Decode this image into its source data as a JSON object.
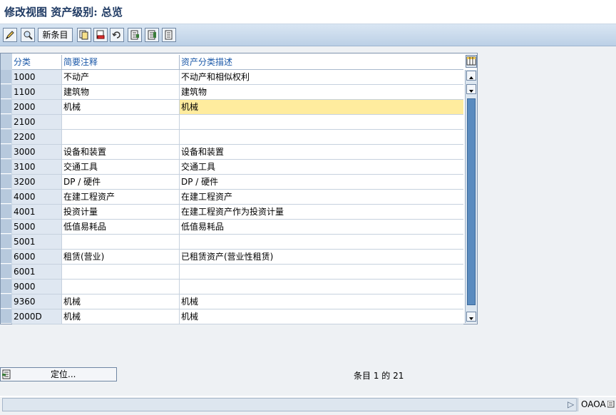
{
  "title": "修改视图 资产级别: 总览",
  "toolbar": {
    "new_entries_label": "新条目",
    "icons": [
      "edit-icon",
      "display-icon",
      "copy-icon",
      "delete-icon",
      "undo-icon",
      "select-all-icon",
      "select-block-icon",
      "deselect-all-icon"
    ]
  },
  "table": {
    "headers": [
      "分类",
      "简要注释",
      "资产分类描述"
    ],
    "rows": [
      {
        "key": "1000",
        "short": "不动产",
        "desc": "不动产和相似权利"
      },
      {
        "key": "1100",
        "short": "建筑物",
        "desc": "建筑物"
      },
      {
        "key": "2000",
        "short": "机械",
        "desc": "机械"
      },
      {
        "key": "2100",
        "short": "",
        "desc": ""
      },
      {
        "key": "2200",
        "short": "",
        "desc": ""
      },
      {
        "key": "3000",
        "short": "设备和装置",
        "desc": "设备和装置"
      },
      {
        "key": "3100",
        "short": "交通工具",
        "desc": "交通工具"
      },
      {
        "key": "3200",
        "short": "DP / 硬件",
        "desc": "DP / 硬件"
      },
      {
        "key": "4000",
        "short": "在建工程资产",
        "desc": "在建工程资产"
      },
      {
        "key": "4001",
        "short": "投资计量",
        "desc": "在建工程资产作为投资计量"
      },
      {
        "key": "5000",
        "short": "低值易耗品",
        "desc": "低值易耗品"
      },
      {
        "key": "5001",
        "short": "",
        "desc": ""
      },
      {
        "key": "6000",
        "short": "租赁(营业)",
        "desc": "已租赁资产(营业性租赁)"
      },
      {
        "key": "6001",
        "short": "",
        "desc": ""
      },
      {
        "key": "9000",
        "short": "",
        "desc": ""
      },
      {
        "key": "9360",
        "short": "机械",
        "desc": "机械"
      },
      {
        "key": "2000D",
        "short": "机械",
        "desc": "机械"
      }
    ],
    "selected_row": 2
  },
  "position_button_label": "定位...",
  "entry_count_text": "条目 1 的 21",
  "status": {
    "client": "OAOA"
  },
  "colors": {
    "selected_cell": "#ffec9e",
    "key_column": "#dfe7f1",
    "header_text": "#1b58a8",
    "toolbar": "#bcd0e6"
  }
}
